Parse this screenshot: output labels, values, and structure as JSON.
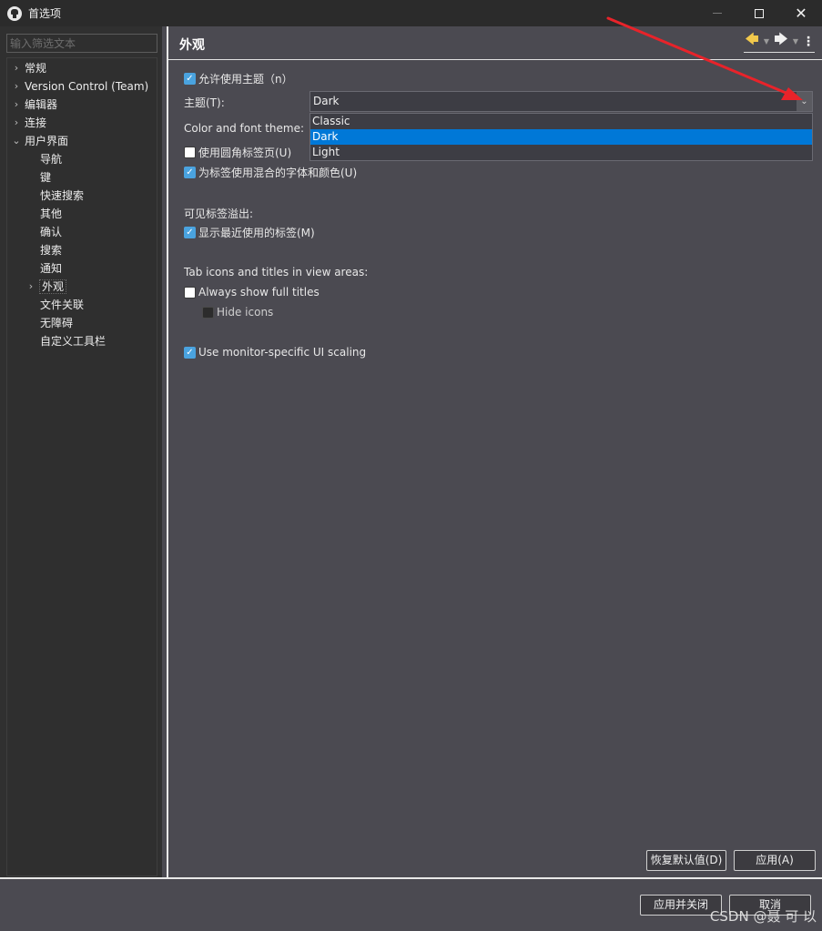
{
  "window": {
    "title": "首选项",
    "close_glyph": "✕"
  },
  "filter": {
    "placeholder": "输入筛选文本"
  },
  "tree": {
    "items": [
      {
        "label": "常规"
      },
      {
        "label": "Version Control (Team)"
      },
      {
        "label": "编辑器"
      },
      {
        "label": "连接"
      },
      {
        "label": "用户界面"
      },
      {
        "label": "导航"
      },
      {
        "label": "键"
      },
      {
        "label": "快速搜索"
      },
      {
        "label": "其他"
      },
      {
        "label": "确认"
      },
      {
        "label": "搜索"
      },
      {
        "label": "通知"
      },
      {
        "label": "外观"
      },
      {
        "label": "文件关联"
      },
      {
        "label": "无障碍"
      },
      {
        "label": "自定义工具栏"
      }
    ]
  },
  "page": {
    "title": "外观",
    "enable_theming": "允许使用主题（n）",
    "theme_label": "主题(T):",
    "theme_value": "Dark",
    "theme_options": [
      "Classic",
      "Dark",
      "Light"
    ],
    "color_font_label": "Color and font theme:",
    "rounded_tabs": "使用圆角标签页(U)",
    "mixed_fonts": "为标签使用混合的字体和颜色(U)",
    "visible_tabs_label": "可见标签溢出:",
    "show_recent_tabs": "显示最近使用的标签(M)",
    "tab_icons_label": "Tab icons and titles in view areas:",
    "always_full_titles": "Always show full titles",
    "hide_icons": "Hide icons",
    "monitor_scaling": "Use monitor-specific UI scaling",
    "restore_defaults": "恢复默认值(D)",
    "apply": "应用(A)"
  },
  "footer": {
    "apply_close": "应用并关闭",
    "cancel": "取消"
  },
  "watermark": "CSDN @聂 可 以",
  "colors": {
    "accent": "#0078d7",
    "checkbox_on": "#4aa3df",
    "annotation_arrow": "#e8232a"
  }
}
